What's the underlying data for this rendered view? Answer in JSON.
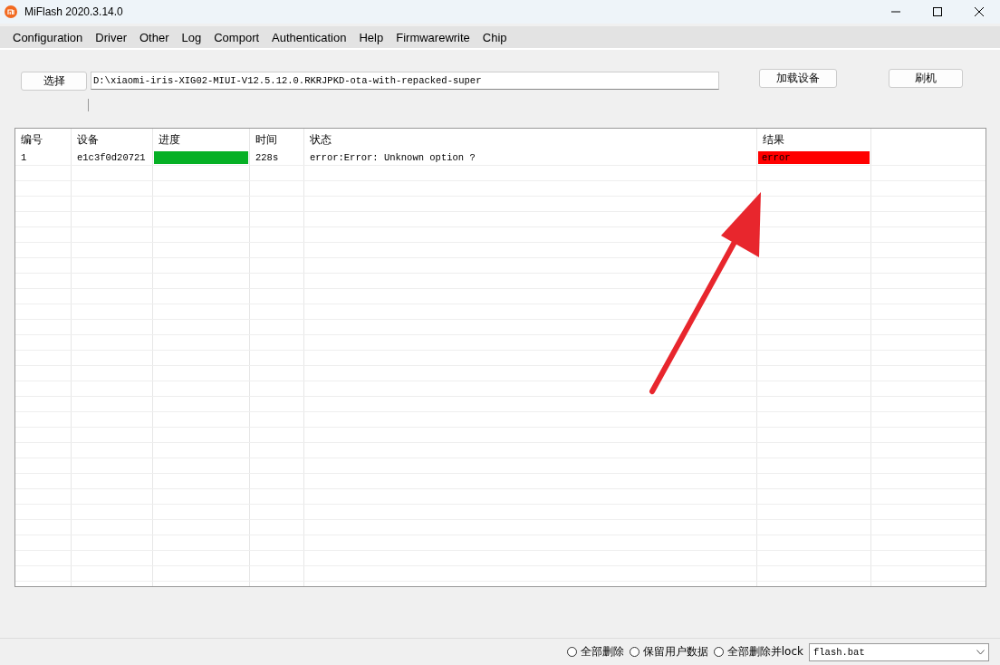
{
  "window": {
    "title": "MiFlash 2020.3.14.0"
  },
  "menu": [
    "Configuration",
    "Driver",
    "Other",
    "Log",
    "Comport",
    "Authentication",
    "Help",
    "Firmwarewrite",
    "Chip"
  ],
  "select_button": "选择",
  "path_field": {
    "value": "D:\\xiaomi-iris-XIG02-MIUI-V12.5.12.0.RKRJPKD-ota-with-repacked-super"
  },
  "load_button": "加载设备",
  "flash_button": "刷机",
  "table": {
    "columns": [
      "编号",
      "设备",
      "进度",
      "时间",
      "状态",
      "结果"
    ],
    "rows": [
      {
        "number": "1",
        "device": "e1c3f0d20721",
        "level": 1,
        "time": "228s",
        "status": "error:Error: Unknown option ?",
        "result": "error",
        "color": "#ff0000"
      }
    ]
  },
  "options": [
    {
      "label": "全部删除",
      "selected": false
    },
    {
      "label": "保留用户数据",
      "selected": false
    },
    {
      "label": "全部删除并lock",
      "selected": false
    }
  ],
  "script_select": {
    "value": "flash.bat"
  }
}
